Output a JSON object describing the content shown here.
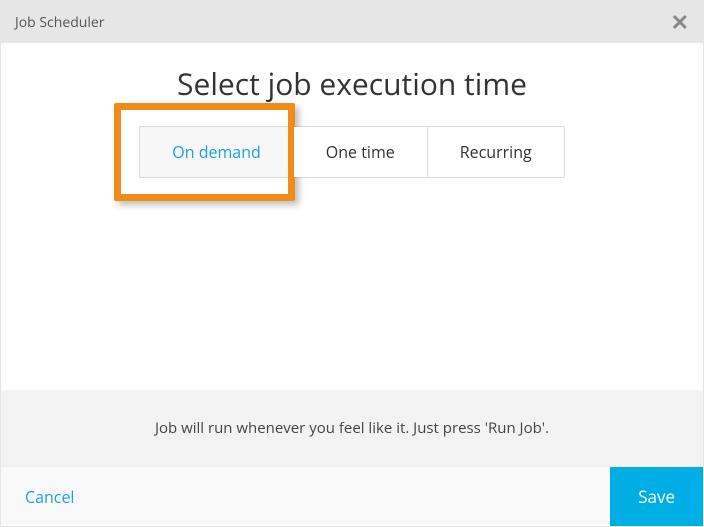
{
  "header": {
    "title": "Job Scheduler"
  },
  "main": {
    "heading": "Select job execution time",
    "tabs": [
      {
        "label": "On demand"
      },
      {
        "label": "One time"
      },
      {
        "label": "Recurring"
      }
    ]
  },
  "info": {
    "text": "Job will run whenever you feel like it. Just press 'Run Job'."
  },
  "footer": {
    "cancel": "Cancel",
    "save": "Save"
  }
}
